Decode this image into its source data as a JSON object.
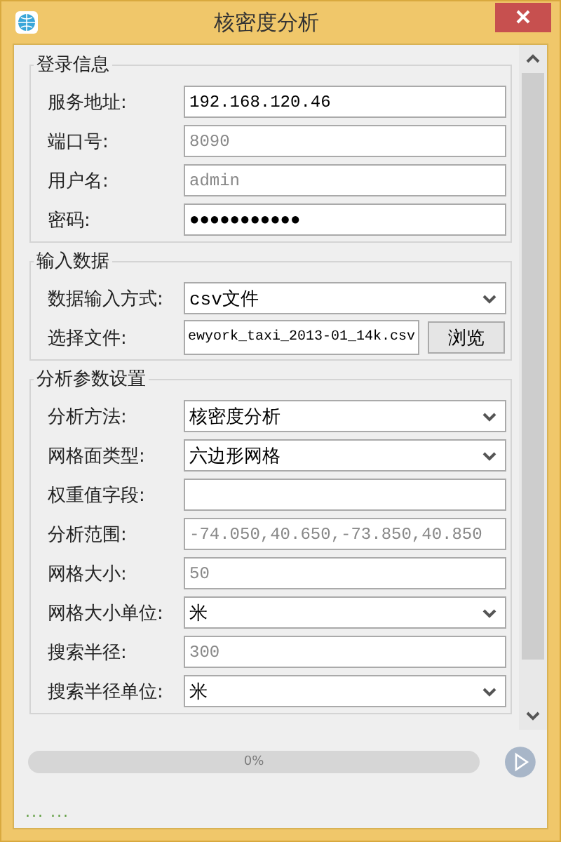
{
  "window": {
    "title": "核密度分析"
  },
  "groups": [
    {
      "title": "登录信息",
      "fields": [
        {
          "kind": "text",
          "label": "服务地址:",
          "value": "192.168.120.46"
        },
        {
          "kind": "text",
          "label": "端口号:",
          "placeholder": "8090"
        },
        {
          "kind": "text",
          "label": "用户名:",
          "placeholder": "admin"
        },
        {
          "kind": "text",
          "label": "密码:",
          "value": "●●●●●●●●●●●"
        }
      ]
    },
    {
      "title": "输入数据",
      "fields": [
        {
          "kind": "select",
          "label": "数据输入方式:",
          "value": "csv文件"
        },
        {
          "kind": "file",
          "label": "选择文件:",
          "value": "ewyork_taxi_2013-01_14k.csv",
          "button": "浏览"
        }
      ]
    },
    {
      "title": "分析参数设置",
      "fields": [
        {
          "kind": "select",
          "label": "分析方法:",
          "value": "核密度分析"
        },
        {
          "kind": "select",
          "label": "网格面类型:",
          "value": "六边形网格"
        },
        {
          "kind": "text",
          "label": "权重值字段:"
        },
        {
          "kind": "text",
          "label": "分析范围:",
          "placeholder": "-74.050,40.650,-73.850,40.850"
        },
        {
          "kind": "text",
          "label": "网格大小:",
          "placeholder": "50"
        },
        {
          "kind": "select",
          "label": "网格大小单位:",
          "value": "米"
        },
        {
          "kind": "text",
          "label": "搜索半径:",
          "placeholder": "300"
        },
        {
          "kind": "select",
          "label": "搜索半径单位:",
          "value": "米"
        }
      ]
    }
  ],
  "progress": {
    "level": 0,
    "reading": "0%"
  },
  "status_bar": "... ..."
}
